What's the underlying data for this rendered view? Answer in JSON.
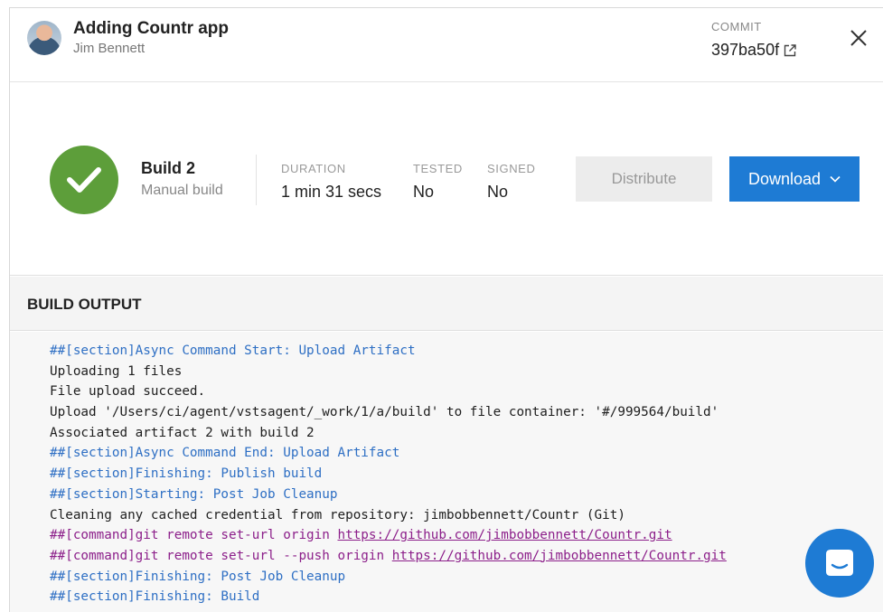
{
  "header": {
    "title": "Adding Countr app",
    "author": "Jim Bennett",
    "commit_label": "COMMIT",
    "commit_hash": "397ba50f"
  },
  "build": {
    "name": "Build 2",
    "type": "Manual build",
    "status": "succeeded",
    "status_color": "#5d9e3a",
    "stats": [
      {
        "label": "DURATION",
        "value": "1 min 31 secs"
      },
      {
        "label": "TESTED",
        "value": "No"
      },
      {
        "label": "SIGNED",
        "value": "No"
      }
    ],
    "distribute_label": "Distribute",
    "download_label": "Download"
  },
  "output": {
    "title": "BUILD OUTPUT",
    "lines": [
      {
        "kind": "section",
        "text": "##[section]Async Command Start: Upload Artifact"
      },
      {
        "kind": "plain",
        "text": "Uploading 1 files"
      },
      {
        "kind": "plain",
        "text": "File upload succeed."
      },
      {
        "kind": "plain",
        "text": "Upload '/Users/ci/agent/vstsagent/_work/1/a/build' to file container: '#/999564/build'"
      },
      {
        "kind": "plain",
        "text": "Associated artifact 2 with build 2"
      },
      {
        "kind": "section",
        "text": "##[section]Async Command End: Upload Artifact"
      },
      {
        "kind": "section",
        "text": "##[section]Finishing: Publish build"
      },
      {
        "kind": "section",
        "text": "##[section]Starting: Post Job Cleanup"
      },
      {
        "kind": "plain",
        "text": "Cleaning any cached credential from repository: jimbobbennett/Countr (Git)"
      },
      {
        "kind": "command",
        "text": "##[command]git remote set-url origin ",
        "link": "https://github.com/jimbobbennett/Countr.git"
      },
      {
        "kind": "command",
        "text": "##[command]git remote set-url --push origin ",
        "link": "https://github.com/jimbobbennett/Countr.git"
      },
      {
        "kind": "section",
        "text": "##[section]Finishing: Post Job Cleanup"
      },
      {
        "kind": "section",
        "text": "##[section]Finishing: Build"
      }
    ]
  },
  "colors": {
    "accent": "#1e7bd4",
    "success": "#5d9e3a",
    "section_text": "#2e6fc4",
    "command_text": "#8c1f8a"
  },
  "icons": [
    "avatar",
    "external-link-icon",
    "close-icon",
    "checkmark-icon",
    "chevron-down-icon",
    "chat-icon"
  ]
}
